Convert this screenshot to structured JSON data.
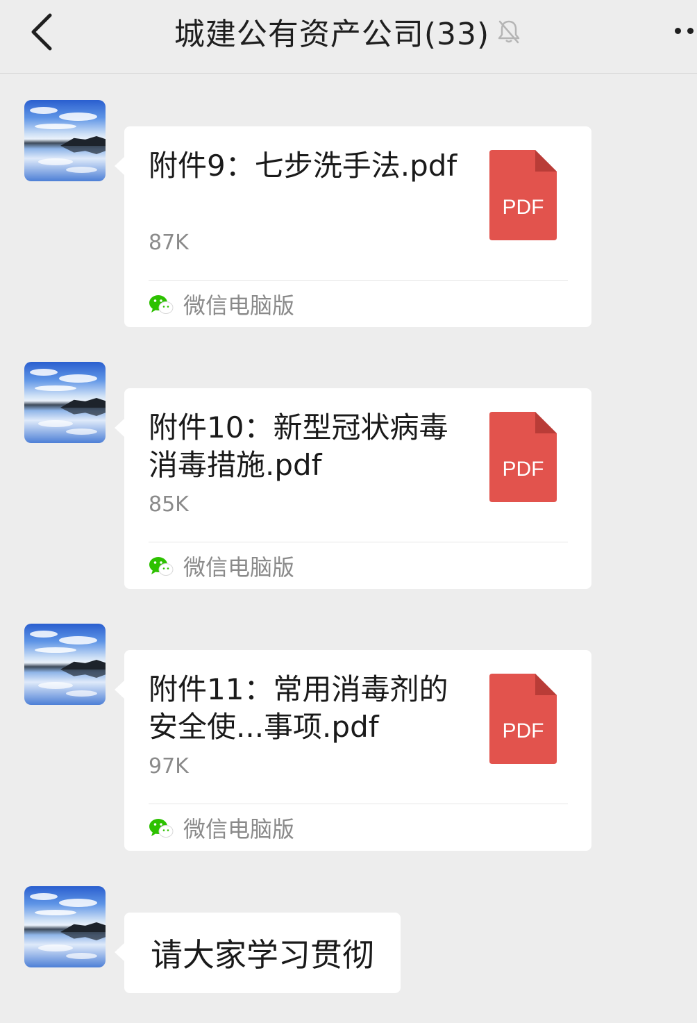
{
  "header": {
    "title": "城建公有资产公司(33)",
    "back_icon": "chevron-left-icon",
    "mute_icon": "bell-off-icon",
    "more_icon": "more-dots-icon"
  },
  "colors": {
    "background": "#ededed",
    "bubble": "#ffffff",
    "pdf_red": "#e2534d",
    "wechat_green": "#2dc100",
    "secondary_text": "#8a8a8a"
  },
  "messages": [
    {
      "type": "file",
      "file_name": "附件9：七步洗手法.pdf",
      "file_size": "87K",
      "file_icon_label": "PDF",
      "source_label": "微信电脑版"
    },
    {
      "type": "file",
      "file_name": "附件10：新型冠状病毒消毒措施.pdf",
      "file_size": "85K",
      "file_icon_label": "PDF",
      "source_label": "微信电脑版"
    },
    {
      "type": "file",
      "file_name": "附件11：常用消毒剂的安全使...事项.pdf",
      "file_size": "97K",
      "file_icon_label": "PDF",
      "source_label": "微信电脑版"
    },
    {
      "type": "text",
      "text": "请大家学习贯彻"
    }
  ]
}
